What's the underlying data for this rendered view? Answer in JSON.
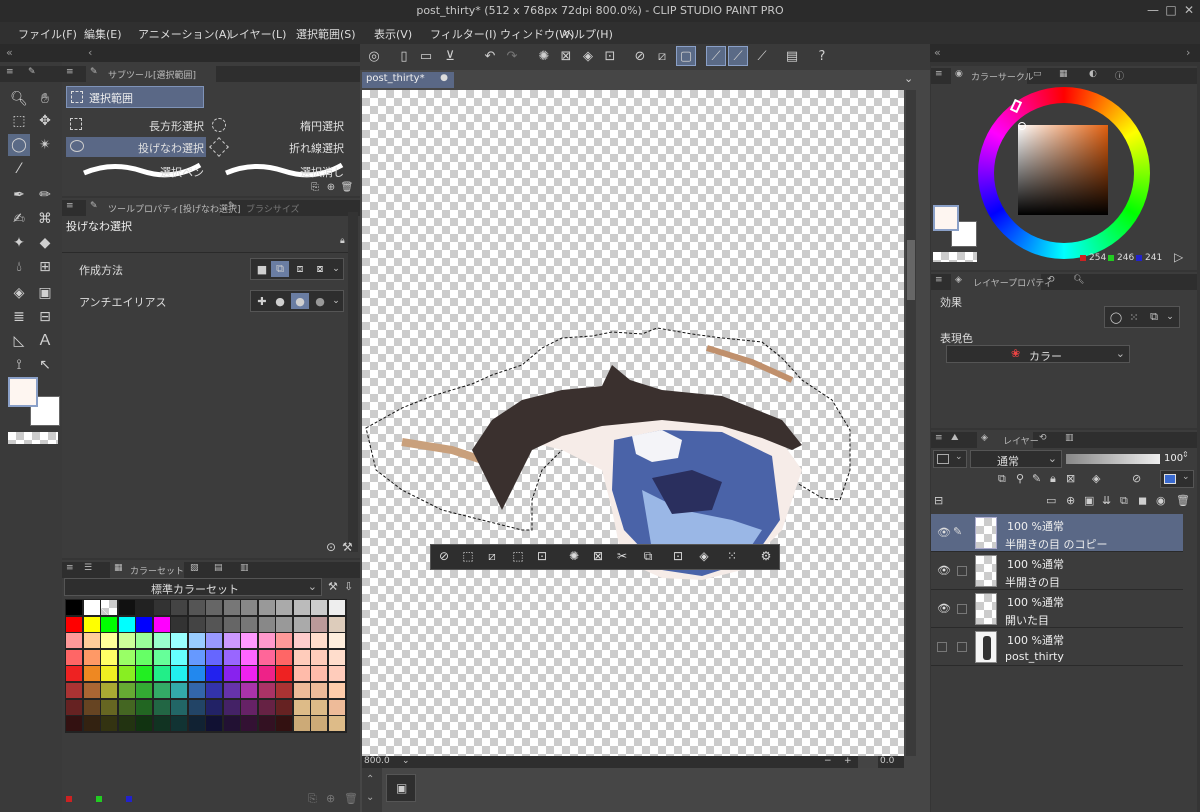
{
  "window": {
    "title": "post_thirty* (512 x 768px 72dpi 800.0%) - CLIP STUDIO PAINT PRO"
  },
  "menu": [
    "ファイル(F)",
    "編集(E)",
    "アニメーション(A)",
    "レイヤー(L)",
    "選択範囲(S)",
    "表示(V)",
    "フィルター(I)",
    "ウィンドウ(W)",
    "ヘルプ(H)"
  ],
  "canvas_tab": {
    "label": "post_thirty*"
  },
  "subtool": {
    "tab_label": "サブツール[選択範囲]",
    "group": "選択範囲",
    "items": [
      "長方形選択",
      "楕円選択",
      "投げなわ選択",
      "折れ線選択",
      "選択ペン",
      "選択消し"
    ]
  },
  "toolprop": {
    "tab_label": "ツールプロパティ[投げなわ選択]",
    "tab2_label": "ブラシサイズ",
    "tool_name": "投げなわ選択",
    "rows": [
      {
        "label": "作成方法"
      },
      {
        "label": "アンチエイリアス"
      }
    ]
  },
  "colorset": {
    "tab_label": "カラーセット",
    "set_name": "標準カラーセット"
  },
  "colorwheel": {
    "tab_label": "カラーサークル",
    "r": "254",
    "g": "246",
    "b": "241",
    "main_color": "#fef6f1"
  },
  "layerprop": {
    "tab_label": "レイヤープロパティ",
    "effect_label": "効果",
    "expr_label": "表現色",
    "expr_value": "カラー"
  },
  "layers_panel": {
    "tab_label": "レイヤー",
    "blend": "通常",
    "opacity": "100",
    "items": [
      {
        "blend": "100 %通常",
        "name": "半開きの目 のコピー",
        "selected": true
      },
      {
        "blend": "100 %通常",
        "name": "半開きの目",
        "selected": false
      },
      {
        "blend": "100 %通常",
        "name": "開いた目",
        "selected": false
      },
      {
        "blend": "100 %通常",
        "name": "post_thirty",
        "selected": false
      }
    ]
  },
  "statusbar": {
    "zoom": "800.0",
    "angle": "0.0"
  },
  "colors": {
    "accent": "#5a6886",
    "selection": "#5a6a86"
  }
}
